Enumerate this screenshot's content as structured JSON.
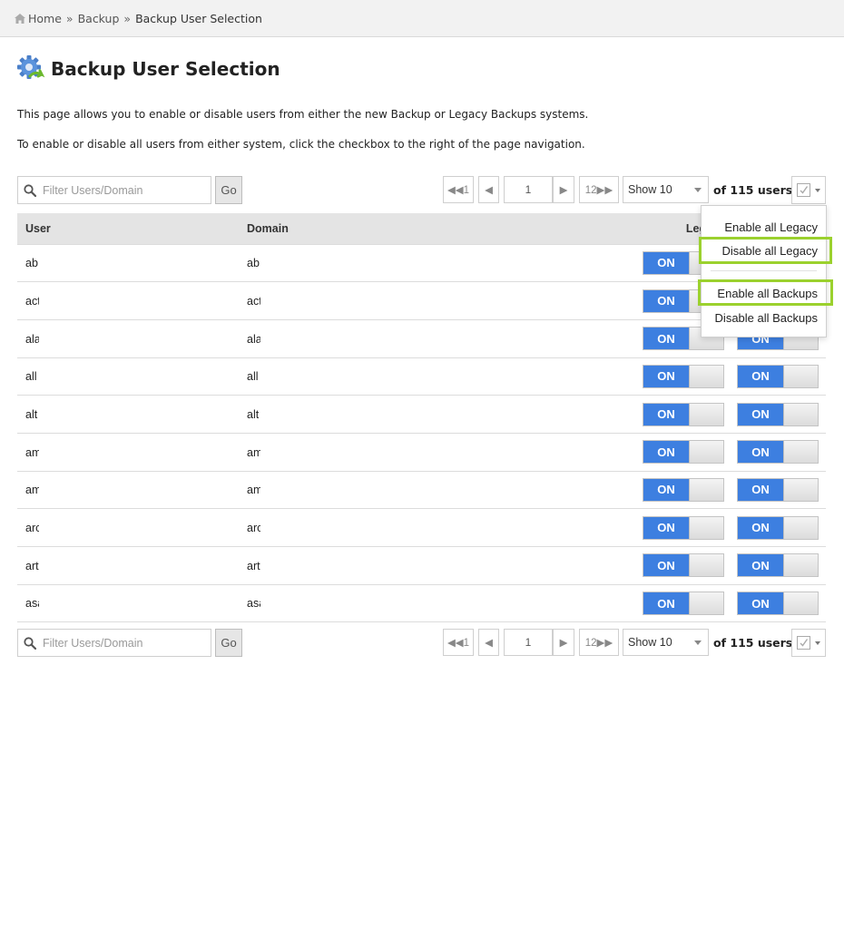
{
  "breadcrumb": {
    "home": "Home",
    "sep": "»",
    "backup": "Backup",
    "current": "Backup User Selection"
  },
  "page": {
    "title": "Backup User Selection",
    "description1": "This page allows you to enable or disable users from either the new Backup or Legacy Backups systems.",
    "description2": "To enable or disable all users from either system, click the checkbox to the right of the page navigation."
  },
  "toolbar": {
    "filter_placeholder": "Filter Users/Domain",
    "go_label": "Go",
    "first_label": "◀◀1",
    "prev_label": "◀",
    "page_value": "1",
    "next_label": "▶",
    "last_label": "12▶▶",
    "show_label": "Show 10",
    "of_users": "of 115 users."
  },
  "table": {
    "headers": {
      "user": "User",
      "domain": "Domain",
      "legacy": "Legacy",
      "backup": ""
    },
    "toggle_on_label": "ON",
    "rows": [
      {
        "user": "ab",
        "domain": "ab"
      },
      {
        "user": "act",
        "domain": "act"
      },
      {
        "user": "ala",
        "domain": "ala"
      },
      {
        "user": "all",
        "domain": "all"
      },
      {
        "user": "alt",
        "domain": "alt"
      },
      {
        "user": "am",
        "domain": "am"
      },
      {
        "user": "am",
        "domain": "am"
      },
      {
        "user": "arc",
        "domain": "arc"
      },
      {
        "user": "art",
        "domain": "art"
      },
      {
        "user": "asa",
        "domain": "asa"
      }
    ]
  },
  "dropdown": {
    "enable_legacy": "Enable all Legacy",
    "disable_legacy": "Disable all Legacy",
    "enable_backups": "Enable all Backups",
    "disable_backups": "Disable all Backups"
  },
  "colors": {
    "toggle_on": "#3d7fe0",
    "highlight": "#9bd12e",
    "header_bg": "#e4e4e4"
  },
  "icons": {
    "home": "home-icon",
    "gear": "gear-backup-icon",
    "search": "search-icon",
    "check": "checkmark-icon"
  }
}
